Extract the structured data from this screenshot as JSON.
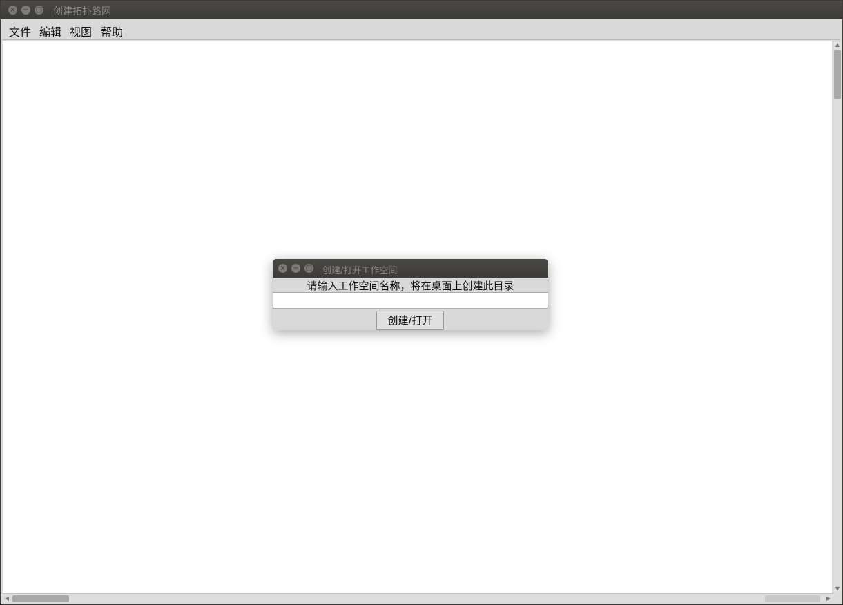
{
  "main_window": {
    "title": "创建拓扑路网",
    "controls": {
      "close": "×",
      "minimize": "−",
      "maximize": "□"
    }
  },
  "menubar": {
    "items": [
      "文件",
      "编辑",
      "视图",
      "帮助"
    ]
  },
  "scrollbars": {
    "up": "▲",
    "down": "▼",
    "left": "◀",
    "right": "▶"
  },
  "dialog": {
    "title": "创建/打开工作空间",
    "prompt": "请输入工作空间名称，将在桌面上创建此目录",
    "input_value": "",
    "button_label": "创建/打开"
  }
}
